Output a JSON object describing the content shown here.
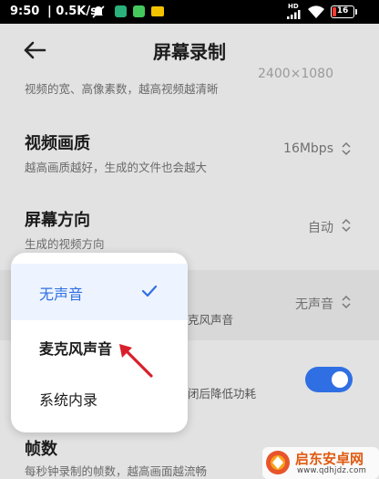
{
  "status_bar": {
    "time": "9:50",
    "speed": "0.5K/s",
    "separator": "|",
    "network_badge": "HD",
    "battery": "16",
    "battery_fraction": 0.16,
    "battery_color": "#ff3b30",
    "icons": [
      "mute-icon",
      "app-badge-green",
      "app-badge-green-download",
      "sim-badge",
      "signal-icon",
      "wifi-icon",
      "battery-icon"
    ]
  },
  "header": {
    "title": "屏幕录制",
    "back_icon": "arrow-left"
  },
  "settings": {
    "resolution": {
      "desc": "视频的宽、高像素数，越高视频越清晰",
      "value": "2400×1080"
    },
    "quality": {
      "title": "视频画质",
      "desc": "越高画质越好，生成的文件也会越大",
      "value": "16Mbps"
    },
    "orientation": {
      "title": "屏幕方向",
      "desc": "生成的视频方向",
      "value": "自动"
    },
    "sound": {
      "value": "无声音",
      "desc_fragment": "克风声音"
    },
    "optimize": {
      "desc_fragment": "闭后降低功耗",
      "enabled": true
    },
    "fps": {
      "title": "帧数",
      "desc": "每秒钟录制的帧数，越高画面越流畅"
    }
  },
  "sound_menu": {
    "options": [
      {
        "label": "无声音",
        "selected": true
      },
      {
        "label": "麦克风声音",
        "selected": false
      },
      {
        "label": "系统内录",
        "selected": false
      }
    ]
  },
  "watermark": {
    "title": "启东安卓网",
    "url": "www.qdhjdz.com"
  },
  "colors": {
    "accent": "#2f6fe3",
    "annotation_arrow": "#d8202c",
    "background": "#e2e2e2"
  }
}
